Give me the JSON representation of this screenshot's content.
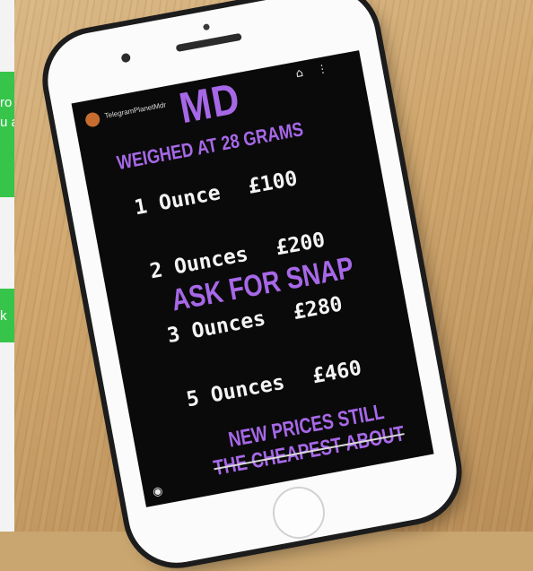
{
  "left_panel": {
    "bubble_1_lines": [
      "ro",
      "u a"
    ],
    "bubble_2_text": "k"
  },
  "story": {
    "username": "TelegramPlanetMdr",
    "title": "MD",
    "subtitle": "WEIGHED AT 28 GRAMS",
    "prices": [
      {
        "qty": "1 Ounce",
        "price": "£100"
      },
      {
        "qty": "2 Ounces",
        "price": "£200"
      },
      {
        "qty": "3 Ounces",
        "price": "£280"
      },
      {
        "qty": "5 Ounces",
        "price": "£460"
      }
    ],
    "overlay": "ASK FOR SNAP",
    "footer_line1": "NEW PRICES STILL",
    "footer_line2": "THE CHEAPEST ABOUT"
  },
  "icons": {
    "home": "home-icon",
    "more": "more-vertical-icon",
    "camera": "camera-icon"
  },
  "colors": {
    "text_purple": "#a768e8",
    "text_white": "#f4f4f4",
    "chat_green": "#37c44a"
  }
}
